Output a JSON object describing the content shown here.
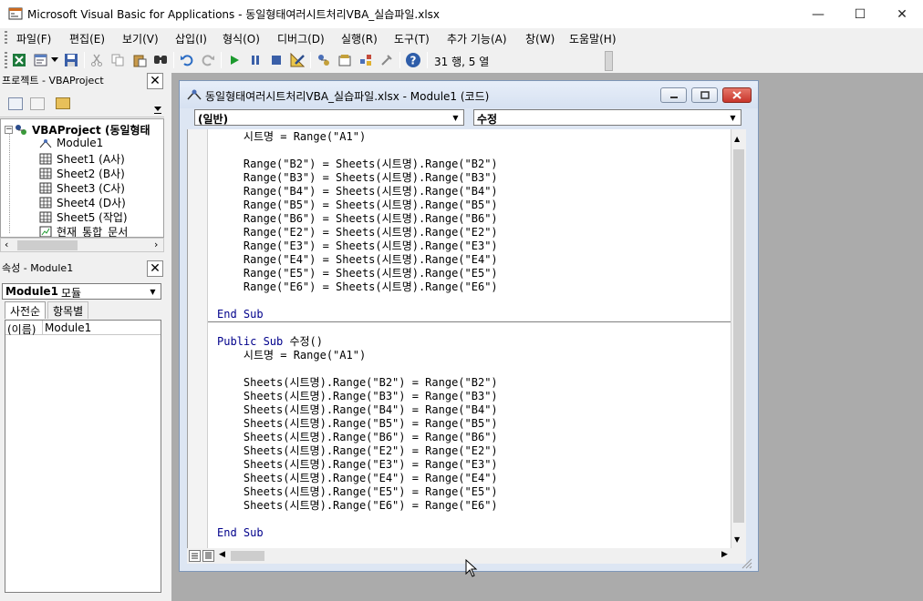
{
  "window": {
    "title": "Microsoft Visual Basic for Applications - 동일형태여러시트처리VBA_실습파일.xlsx",
    "controls": {
      "minimize": "—",
      "maximize": "☐",
      "close": "✕"
    }
  },
  "menu": [
    "파일(F)",
    "편집(E)",
    "보기(V)",
    "삽입(I)",
    "형식(O)",
    "디버그(D)",
    "실행(R)",
    "도구(T)",
    "추가 기능(A)",
    "창(W)",
    "도움말(H)"
  ],
  "toolbar": {
    "cursor_position": "31 행, 5 열",
    "icons": [
      "excel-icon",
      "insert-module-icon",
      "save-icon",
      "cut-icon",
      "copy-icon",
      "paste-icon",
      "find-icon",
      "undo-icon",
      "redo-icon",
      "run-icon",
      "break-icon",
      "reset-icon",
      "design-mode-icon",
      "project-explorer-icon",
      "properties-icon",
      "object-browser-icon",
      "toolbox-icon",
      "help-icon"
    ]
  },
  "project_pane": {
    "title": "프로젝트 - VBAProject",
    "close": "✕",
    "root": "VBAProject (동일형태",
    "items": [
      "Module1",
      "Sheet1 (A사)",
      "Sheet2 (B사)",
      "Sheet3 (C사)",
      "Sheet4 (D사)",
      "Sheet5 (작업)",
      "현재_통합_문서"
    ]
  },
  "properties_pane": {
    "title": "속성 - Module1",
    "close": "✕",
    "object_name": "Module1",
    "object_type": "모듈",
    "tabs": [
      "사전순",
      "항목별"
    ],
    "rows": [
      {
        "name": "(이름)",
        "value": "Module1"
      }
    ]
  },
  "code_window": {
    "title": "동일형태여러시트처리VBA_실습파일.xlsx - Module1 (코드)",
    "object_combo": "(일반)",
    "procedure_combo": "수정",
    "lines": [
      "    시트명 = Range(\"A1\")",
      "",
      "    Range(\"B2\") = Sheets(시트명).Range(\"B2\")",
      "    Range(\"B3\") = Sheets(시트명).Range(\"B3\")",
      "    Range(\"B4\") = Sheets(시트명).Range(\"B4\")",
      "    Range(\"B5\") = Sheets(시트명).Range(\"B5\")",
      "    Range(\"B6\") = Sheets(시트명).Range(\"B6\")",
      "    Range(\"E2\") = Sheets(시트명).Range(\"E2\")",
      "    Range(\"E3\") = Sheets(시트명).Range(\"E3\")",
      "    Range(\"E4\") = Sheets(시트명).Range(\"E4\")",
      "    Range(\"E5\") = Sheets(시트명).Range(\"E5\")",
      "    Range(\"E6\") = Sheets(시트명).Range(\"E6\")",
      "",
      "End Sub",
      "",
      "Public Sub 수정()",
      "    시트명 = Range(\"A1\")",
      "",
      "    Sheets(시트명).Range(\"B2\") = Range(\"B2\")",
      "    Sheets(시트명).Range(\"B3\") = Range(\"B3\")",
      "    Sheets(시트명).Range(\"B4\") = Range(\"B4\")",
      "    Sheets(시트명).Range(\"B5\") = Range(\"B5\")",
      "    Sheets(시트명).Range(\"B6\") = Range(\"B6\")",
      "    Sheets(시트명).Range(\"E2\") = Range(\"E2\")",
      "    Sheets(시트명).Range(\"E3\") = Range(\"E3\")",
      "    Sheets(시트명).Range(\"E4\") = Range(\"E4\")",
      "    Sheets(시트명).Range(\"E5\") = Range(\"E5\")",
      "    Sheets(시트명).Range(\"E6\") = Range(\"E6\")",
      "",
      "End Sub"
    ]
  },
  "colors": {
    "keyword": "#00008b",
    "mdi_background": "#ababab",
    "close_button": "#c8352b"
  }
}
